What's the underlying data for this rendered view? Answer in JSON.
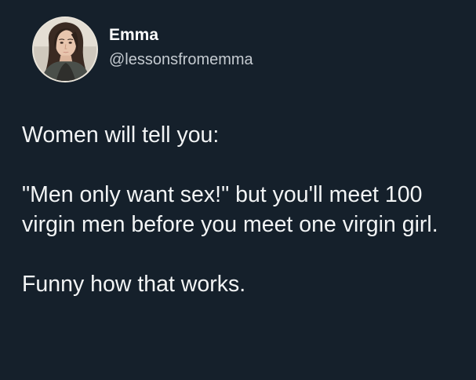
{
  "author": {
    "display_name": "Emma",
    "handle": "@lessonsfromemma",
    "avatar_icon": "profile-photo"
  },
  "post": {
    "paragraphs": [
      "Women will tell you:",
      "\"Men only want sex!\" but you'll meet 100 virgin men before you meet one virgin girl.",
      "Funny how that works."
    ]
  },
  "colors": {
    "background": "#15202b",
    "text": "#f2f4f5",
    "handle": "#c4cad0"
  }
}
